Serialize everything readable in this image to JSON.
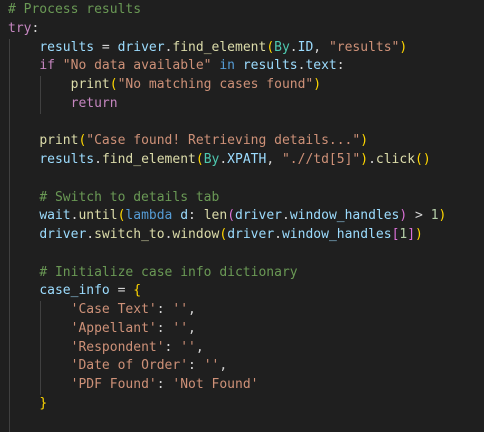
{
  "colors": {
    "background": "#1f1f1f",
    "comment": "#6a9955",
    "keyword_control": "#c586c0",
    "keyword": "#569cd6",
    "variable": "#9cdcfe",
    "function": "#dcdcaa",
    "class": "#4ec9b0",
    "string": "#ce9178",
    "number": "#b5cea8",
    "bracket_level_1": "#ffd700",
    "bracket_level_2": "#da70d6",
    "bracket_level_3": "#179fff"
  },
  "lines": [
    {
      "indent": 0,
      "tokens": [
        [
          "c-comment",
          "# Process results"
        ]
      ]
    },
    {
      "indent": 0,
      "tokens": [
        [
          "c-kw-flow",
          "try"
        ],
        [
          "c-op",
          ":"
        ]
      ]
    },
    {
      "indent": 1,
      "tokens": [
        [
          "c-var",
          "results"
        ],
        [
          "c-op",
          " = "
        ],
        [
          "c-var",
          "driver"
        ],
        [
          "c-op",
          "."
        ],
        [
          "c-fn",
          "find_element"
        ],
        [
          "c-b1",
          "("
        ],
        [
          "c-cls",
          "By"
        ],
        [
          "c-op",
          "."
        ],
        [
          "c-var",
          "ID"
        ],
        [
          "c-op",
          ", "
        ],
        [
          "c-str",
          "\"results\""
        ],
        [
          "c-b1",
          ")"
        ]
      ]
    },
    {
      "indent": 1,
      "tokens": [
        [
          "c-kw-flow",
          "if"
        ],
        [
          "c-op",
          " "
        ],
        [
          "c-str",
          "\"No data available\""
        ],
        [
          "c-op",
          " "
        ],
        [
          "c-kw",
          "in"
        ],
        [
          "c-op",
          " "
        ],
        [
          "c-var",
          "results"
        ],
        [
          "c-op",
          "."
        ],
        [
          "c-var",
          "text"
        ],
        [
          "c-op",
          ":"
        ]
      ]
    },
    {
      "indent": 2,
      "tokens": [
        [
          "c-fn",
          "print"
        ],
        [
          "c-b1",
          "("
        ],
        [
          "c-str",
          "\"No matching cases found\""
        ],
        [
          "c-b1",
          ")"
        ]
      ]
    },
    {
      "indent": 2,
      "tokens": [
        [
          "c-kw-flow",
          "return"
        ]
      ]
    },
    {
      "indent": 1,
      "tokens": []
    },
    {
      "indent": 1,
      "tokens": [
        [
          "c-fn",
          "print"
        ],
        [
          "c-b1",
          "("
        ],
        [
          "c-str",
          "\"Case found! Retrieving details...\""
        ],
        [
          "c-b1",
          ")"
        ]
      ]
    },
    {
      "indent": 1,
      "tokens": [
        [
          "c-var",
          "results"
        ],
        [
          "c-op",
          "."
        ],
        [
          "c-fn",
          "find_element"
        ],
        [
          "c-b1",
          "("
        ],
        [
          "c-cls",
          "By"
        ],
        [
          "c-op",
          "."
        ],
        [
          "c-var",
          "XPATH"
        ],
        [
          "c-op",
          ", "
        ],
        [
          "c-str",
          "\".//td[5]\""
        ],
        [
          "c-b1",
          ")"
        ],
        [
          "c-op",
          "."
        ],
        [
          "c-fn",
          "click"
        ],
        [
          "c-b1",
          "("
        ],
        [
          "c-b1",
          ")"
        ]
      ]
    },
    {
      "indent": 1,
      "tokens": []
    },
    {
      "indent": 1,
      "tokens": [
        [
          "c-comment",
          "# Switch to details tab"
        ]
      ]
    },
    {
      "indent": 1,
      "tokens": [
        [
          "c-var",
          "wait"
        ],
        [
          "c-op",
          "."
        ],
        [
          "c-fn",
          "until"
        ],
        [
          "c-b1",
          "("
        ],
        [
          "c-kw",
          "lambda"
        ],
        [
          "c-op",
          " "
        ],
        [
          "c-var",
          "d"
        ],
        [
          "c-op",
          ": "
        ],
        [
          "c-fn",
          "len"
        ],
        [
          "c-b2",
          "("
        ],
        [
          "c-var",
          "driver"
        ],
        [
          "c-op",
          "."
        ],
        [
          "c-var",
          "window_handles"
        ],
        [
          "c-b2",
          ")"
        ],
        [
          "c-op",
          " > "
        ],
        [
          "c-num",
          "1"
        ],
        [
          "c-b1",
          ")"
        ]
      ]
    },
    {
      "indent": 1,
      "tokens": [
        [
          "c-var",
          "driver"
        ],
        [
          "c-op",
          "."
        ],
        [
          "c-fn",
          "switch_to"
        ],
        [
          "c-op",
          "."
        ],
        [
          "c-fn",
          "window"
        ],
        [
          "c-b1",
          "("
        ],
        [
          "c-var",
          "driver"
        ],
        [
          "c-op",
          "."
        ],
        [
          "c-var",
          "window_handles"
        ],
        [
          "c-b2",
          "["
        ],
        [
          "c-num",
          "1"
        ],
        [
          "c-b2",
          "]"
        ],
        [
          "c-b1",
          ")"
        ]
      ]
    },
    {
      "indent": 1,
      "tokens": []
    },
    {
      "indent": 1,
      "tokens": [
        [
          "c-comment",
          "# Initialize case info dictionary"
        ]
      ]
    },
    {
      "indent": 1,
      "tokens": [
        [
          "c-var",
          "case_info"
        ],
        [
          "c-op",
          " = "
        ],
        [
          "c-b1",
          "{"
        ]
      ]
    },
    {
      "indent": 2,
      "tokens": [
        [
          "c-str",
          "'Case Text'"
        ],
        [
          "c-op",
          ": "
        ],
        [
          "c-str",
          "''"
        ],
        [
          "c-op",
          ","
        ]
      ]
    },
    {
      "indent": 2,
      "tokens": [
        [
          "c-str",
          "'Appellant'"
        ],
        [
          "c-op",
          ": "
        ],
        [
          "c-str",
          "''"
        ],
        [
          "c-op",
          ","
        ]
      ]
    },
    {
      "indent": 2,
      "tokens": [
        [
          "c-str",
          "'Respondent'"
        ],
        [
          "c-op",
          ": "
        ],
        [
          "c-str",
          "''"
        ],
        [
          "c-op",
          ","
        ]
      ]
    },
    {
      "indent": 2,
      "tokens": [
        [
          "c-str",
          "'Date of Order'"
        ],
        [
          "c-op",
          ": "
        ],
        [
          "c-str",
          "''"
        ],
        [
          "c-op",
          ","
        ]
      ]
    },
    {
      "indent": 2,
      "tokens": [
        [
          "c-str",
          "'PDF Found'"
        ],
        [
          "c-op",
          ": "
        ],
        [
          "c-str",
          "'Not Found'"
        ]
      ]
    },
    {
      "indent": 1,
      "tokens": [
        [
          "c-b1",
          "}"
        ]
      ]
    },
    {
      "indent": 1,
      "tokens": []
    }
  ]
}
